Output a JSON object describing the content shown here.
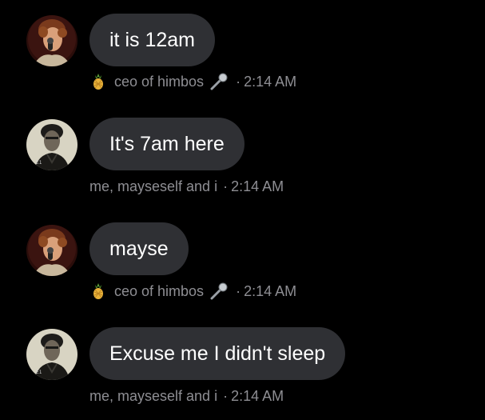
{
  "messages": [
    {
      "sender": "ceo of himbos",
      "text": "it is 12am",
      "time": "2:14 AM",
      "avatar_icon": "singer-avatar-icon",
      "name_prefix_icon": "pineapple-icon",
      "name_suffix_icon": "microphone-icon"
    },
    {
      "sender": "me, mayseself and i",
      "text": "It's 7am here",
      "time": "2:14 AM",
      "avatar_icon": "dark-figure-avatar-icon"
    },
    {
      "sender": "ceo of himbos",
      "text": "mayse",
      "time": "2:14 AM",
      "avatar_icon": "singer-avatar-icon",
      "name_prefix_icon": "pineapple-icon",
      "name_suffix_icon": "microphone-icon"
    },
    {
      "sender": "me, mayseself and i",
      "text": "Excuse me I didn't sleep",
      "time": "2:14 AM",
      "avatar_icon": "dark-figure-avatar-icon"
    }
  ],
  "separator": "·",
  "colors": {
    "background": "#000000",
    "bubble": "#2f3034",
    "bubble_text": "#ffffff",
    "meta_text": "#8e8e93"
  }
}
